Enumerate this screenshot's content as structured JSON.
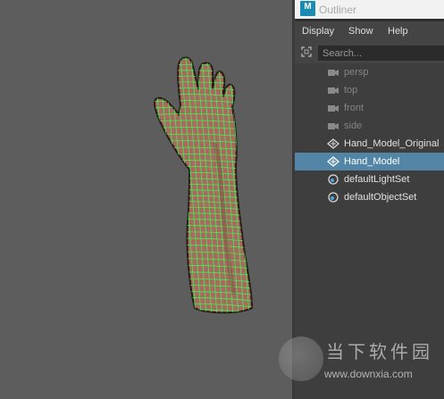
{
  "window": {
    "title": "Outliner",
    "app_icon_letter": "M"
  },
  "menu": {
    "items": [
      "Display",
      "Show",
      "Help"
    ]
  },
  "search": {
    "placeholder": "Search..."
  },
  "outliner": {
    "items": [
      {
        "label": "persp",
        "icon": "camera-icon"
      },
      {
        "label": "top",
        "icon": "camera-icon"
      },
      {
        "label": "front",
        "icon": "camera-icon"
      },
      {
        "label": "side",
        "icon": "camera-icon"
      },
      {
        "label": "Hand_Model_Original",
        "icon": "transform-node-icon"
      },
      {
        "label": "Hand_Model",
        "icon": "transform-node-icon",
        "selected": true
      },
      {
        "label": "defaultLightSet",
        "icon": "object-set-icon"
      },
      {
        "label": "defaultObjectSet",
        "icon": "object-set-icon"
      }
    ]
  },
  "viewport": {
    "object": "hand-mesh",
    "wireframe_color": "#34ff55",
    "skin_color": "#a86a5e"
  },
  "colors": {
    "selection": "#5285a6",
    "viewport_bg": "#5d5d5d",
    "panel_bg": "#444444"
  },
  "watermark": {
    "name": "当下软件园",
    "url": "www.downxia.com"
  }
}
